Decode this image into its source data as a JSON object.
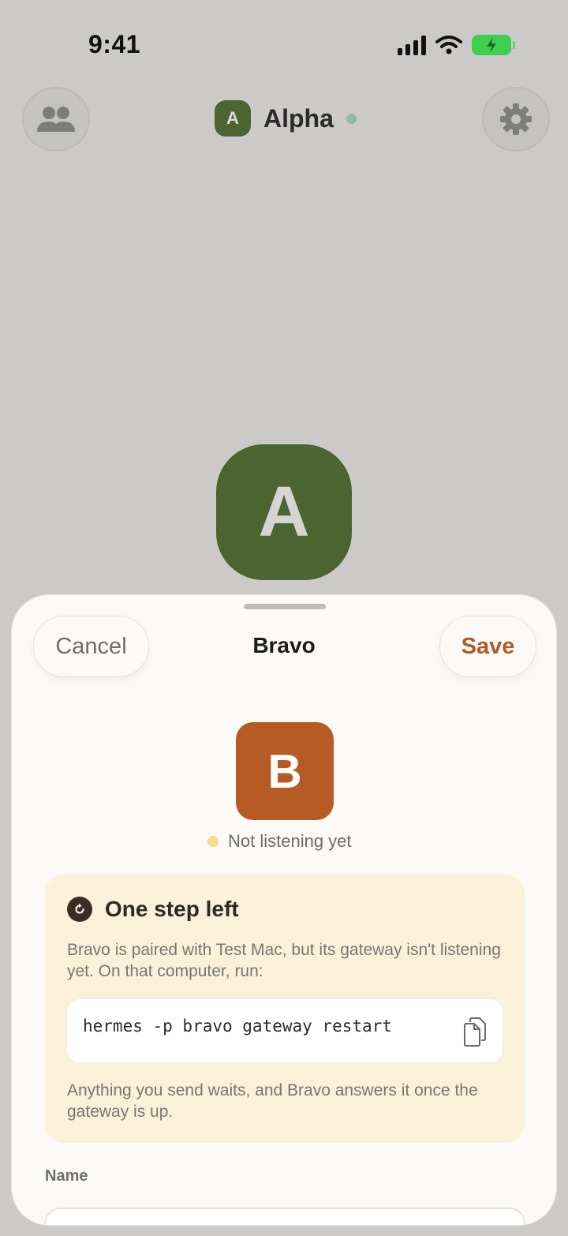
{
  "status_bar": {
    "time": "9:41"
  },
  "header": {
    "agent_initial": "A",
    "agent_name": "Alpha"
  },
  "big_avatar": {
    "initial": "A",
    "color": "#4c6430"
  },
  "sheet": {
    "cancel_label": "Cancel",
    "title": "Bravo",
    "save_label": "Save",
    "avatar_initial": "B",
    "avatar_color": "#b55b23",
    "status_text": "Not listening yet",
    "callout": {
      "title": "One step left",
      "body": "Bravo is paired with Test Mac, but its gateway isn't listening yet. On that computer, run:",
      "command": "hermes -p bravo gateway restart",
      "footer": "Anything you send waits, and Bravo answers it once the gateway is up."
    },
    "name_label": "Name",
    "name_value": ""
  },
  "icons": [
    "signal-icon",
    "wifi-icon",
    "battery-charging-icon",
    "people-icon",
    "gear-icon",
    "refresh-icon",
    "copy-icon"
  ]
}
